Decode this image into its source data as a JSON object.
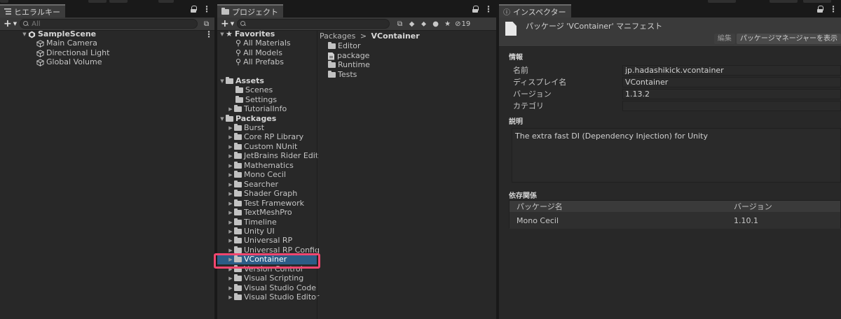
{
  "hierarchy": {
    "tab_label": "ヒエラルキー",
    "search_placeholder": "All",
    "scene": "SampleScene",
    "objects": [
      "Main Camera",
      "Directional Light",
      "Global Volume"
    ]
  },
  "project": {
    "tab_label": "プロジェクト",
    "hidden_count": "19",
    "favorites_label": "Favorites",
    "favorites": [
      "All Materials",
      "All Models",
      "All Prefabs"
    ],
    "assets_label": "Assets",
    "assets": [
      "Scenes",
      "Settings",
      "TutorialInfo"
    ],
    "packages_label": "Packages",
    "packages": [
      "Burst",
      "Core RP Library",
      "Custom NUnit",
      "JetBrains Rider Edit",
      "Mathematics",
      "Mono Cecil",
      "Searcher",
      "Shader Graph",
      "Test Framework",
      "TextMeshPro",
      "Timeline",
      "Unity UI",
      "Universal RP",
      "Universal RP Config",
      "VContainer",
      "Version Control",
      "Visual Scripting",
      "Visual Studio Code",
      "Visual Studio Editor"
    ],
    "selected_package": "VContainer",
    "breadcrumb_root": "Packages",
    "breadcrumb_sep": ">",
    "breadcrumb_current": "VContainer",
    "contents": [
      {
        "name": "Editor",
        "icon": "folder-icon"
      },
      {
        "name": "package",
        "icon": "file-icon"
      },
      {
        "name": "Runtime",
        "icon": "folder-icon"
      },
      {
        "name": "Tests",
        "icon": "folder-icon"
      }
    ]
  },
  "inspector": {
    "tab_label": "インスペクター",
    "title": "パッケージ 'VContainer' マニフェスト",
    "edit_button": "編集",
    "package_manager_button": "パッケージマネージャーを表示",
    "info_label": "情報",
    "fields": [
      {
        "key": "名前",
        "value": "jp.hadashikick.vcontainer"
      },
      {
        "key": "ディスプレイ名",
        "value": "VContainer"
      },
      {
        "key": "バージョン",
        "value": "1.13.2"
      },
      {
        "key": "カテゴリ",
        "value": ""
      }
    ],
    "description_label": "説明",
    "description": "The extra fast DI (Dependency Injection) for Unity",
    "deps_label": "依存関係",
    "deps_headers": [
      "パッケージ名",
      "バージョン"
    ],
    "deps": [
      {
        "name": "Mono Cecil",
        "version": "1.10.1"
      }
    ]
  }
}
